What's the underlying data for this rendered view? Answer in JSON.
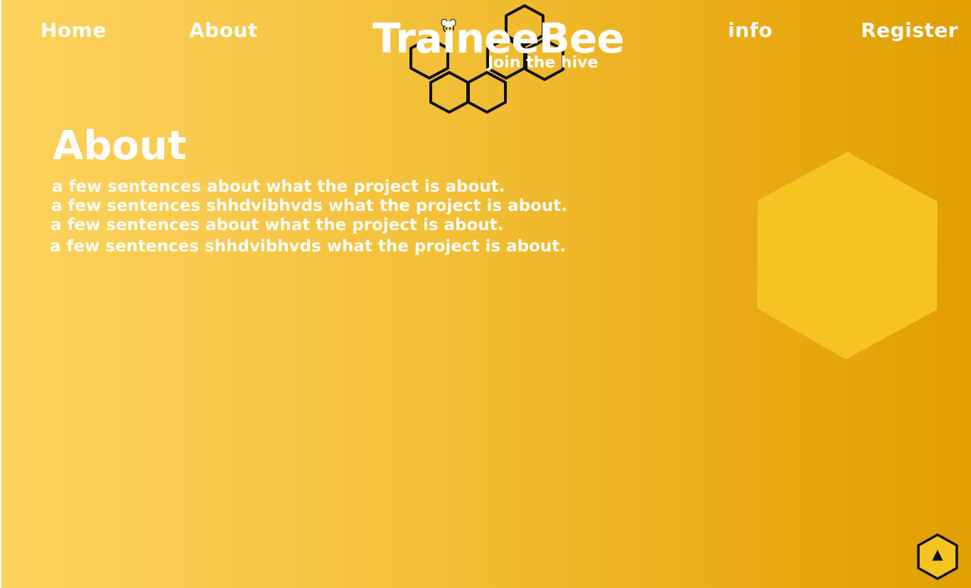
{
  "nav": {
    "home": "Home",
    "about": "About",
    "info": "info",
    "register": "Register"
  },
  "logo": {
    "title": "TraineeBee",
    "tagline": "Join the hive",
    "icons": [
      "bee-icon",
      "honeycomb-icon"
    ]
  },
  "about": {
    "title": "About",
    "lines": [
      "a few sentences about what the project is about.",
      "a few sentences shhdvibhvds what the project is about.",
      "a few sentences about what the project is about.",
      "a few sentences shhdvibhvds what the project is about."
    ]
  },
  "scroll_top": {
    "icon": "chevron-up-icon",
    "glyph": "▲"
  },
  "colors": {
    "gradient_start": "#fdd35d",
    "gradient_end": "#e19f00",
    "hexagon_fill": "#f5c421",
    "text": "#ffffff",
    "outline": "#111111",
    "button_fill": "#f5c421"
  }
}
